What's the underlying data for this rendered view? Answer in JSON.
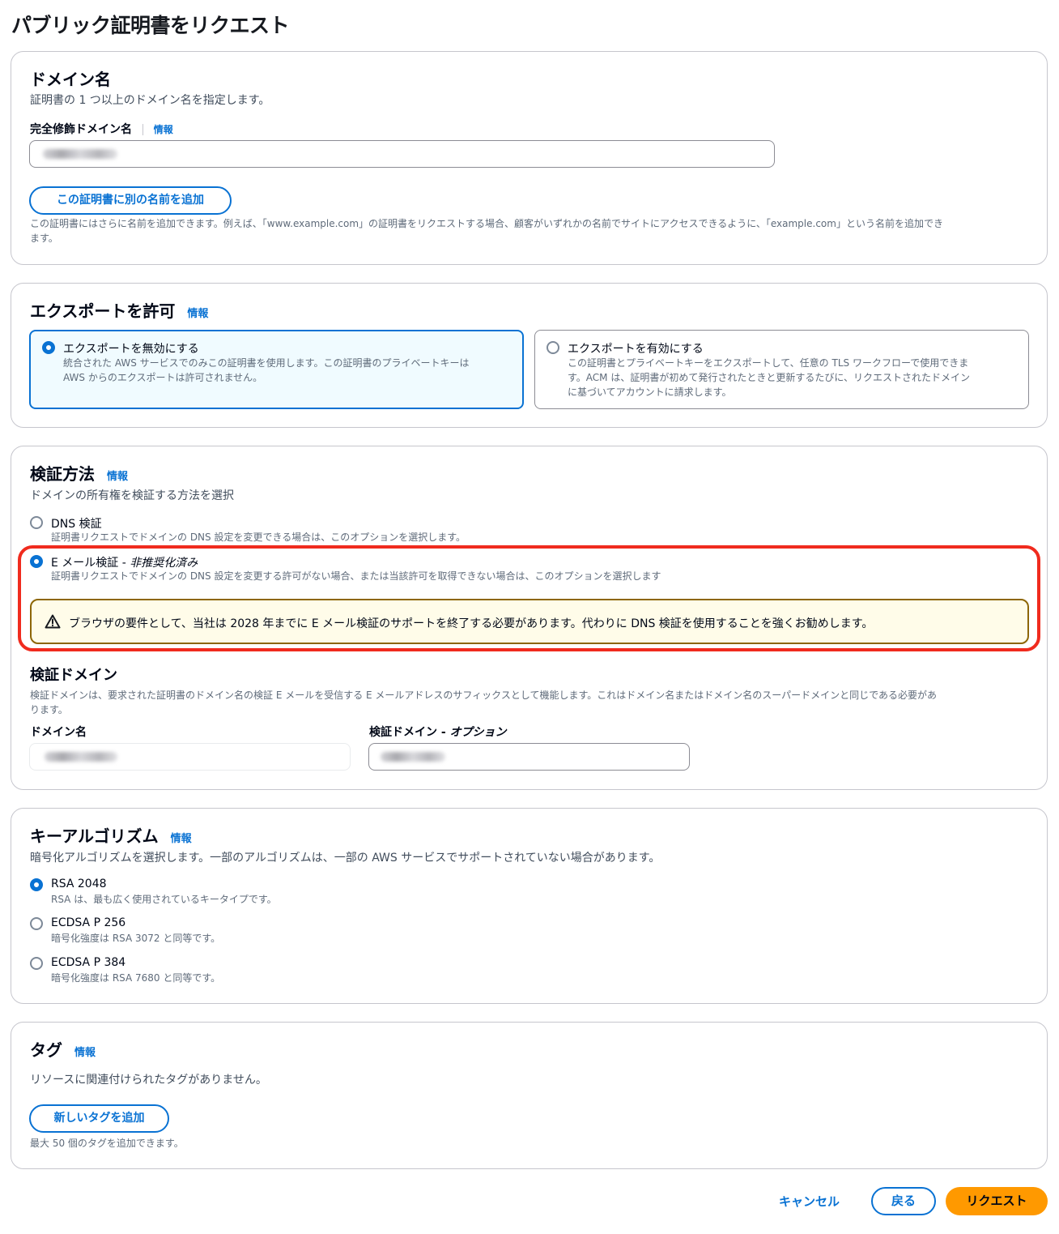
{
  "page_title": "パブリック証明書をリクエスト",
  "info_label": "情報",
  "domain_section": {
    "title": "ドメイン名",
    "description": "証明書の 1 つ以上のドメイン名を指定します。",
    "fqdn_label": "完全修飾ドメイン名",
    "add_name_button": "この証明書に別の名前を追加",
    "hint_line1": "この証明書にはさらに名前を追加できます。例えば、「www.example.com」の証明書をリクエストする場合、顧客がいずれかの名前でサイトにアクセスできるように、「example.com」という名前を追加でき",
    "hint_line2": "ます。"
  },
  "export_section": {
    "title": "エクスポートを許可",
    "options": [
      {
        "label": "エクスポートを無効にする",
        "desc_line1": "統合された AWS サービスでのみこの証明書を使用します。この証明書のプライベートキーは",
        "desc_line2": "AWS からのエクスポートは許可されません。",
        "selected": true
      },
      {
        "label": "エクスポートを有効にする",
        "desc_line1": "この証明書とプライベートキーをエクスポートして、任意の TLS ワークフローで使用できま",
        "desc_line2": "す。ACM は、証明書が初めて発行されたときと更新するたびに、リクエストされたドメイン",
        "desc_line3": "に基づいてアカウントに請求します。",
        "selected": false
      }
    ]
  },
  "validation_section": {
    "title": "検証方法",
    "description": "ドメインの所有権を検証する方法を選択",
    "dns": {
      "label": "DNS 検証",
      "desc": "証明書リクエストでドメインの DNS 設定を変更できる場合は、このオプションを選択します。",
      "selected": false
    },
    "email": {
      "label": "E メール検証 - ",
      "label_suffix": "非推奨化済み",
      "desc": "証明書リクエストでドメインの DNS 設定を変更する許可がない場合、または当該許可を取得できない場合は、このオプションを選択します",
      "selected": true
    },
    "warning": "ブラウザの要件として、当社は 2028 年までに E メール検証のサポートを終了する必要があります。代わりに DNS 検証を使用することを強くお勧めします。",
    "validation_domain": {
      "title": "検証ドメイン",
      "desc_line1": "検証ドメインは、要求された証明書のドメイン名の検証 E メールを受信する E メールアドレスのサフィックスとして機能します。これはドメイン名またはドメイン名のスーパードメインと同じである必要があ",
      "desc_line2": "ります。",
      "domain_label": "ドメイン名",
      "validation_label": "検証ドメイン - ",
      "validation_label_suffix": "オプション"
    }
  },
  "key_section": {
    "title": "キーアルゴリズム",
    "description": "暗号化アルゴリズムを選択します。一部のアルゴリズムは、一部の AWS サービスでサポートされていない場合があります。",
    "options": [
      {
        "label": "RSA 2048",
        "desc": "RSA は、最も広く使用されているキータイプです。",
        "selected": true
      },
      {
        "label": "ECDSA P 256",
        "desc": "暗号化強度は RSA 3072 と同等です。",
        "selected": false
      },
      {
        "label": "ECDSA P 384",
        "desc": "暗号化強度は RSA 7680 と同等です。",
        "selected": false
      }
    ]
  },
  "tags_section": {
    "title": "タグ",
    "empty": "リソースに関連付けられたタグがありません。",
    "add_button": "新しいタグを追加",
    "limit": "最大 50 個のタグを追加できます。"
  },
  "footer": {
    "cancel": "キャンセル",
    "back": "戻る",
    "request": "リクエスト"
  },
  "colors": {
    "accent": "#0972d3",
    "primary_button": "#ff9900",
    "highlight_border": "#f02b1e",
    "warning_border": "#8d6605",
    "warning_bg": "#fffce9"
  }
}
